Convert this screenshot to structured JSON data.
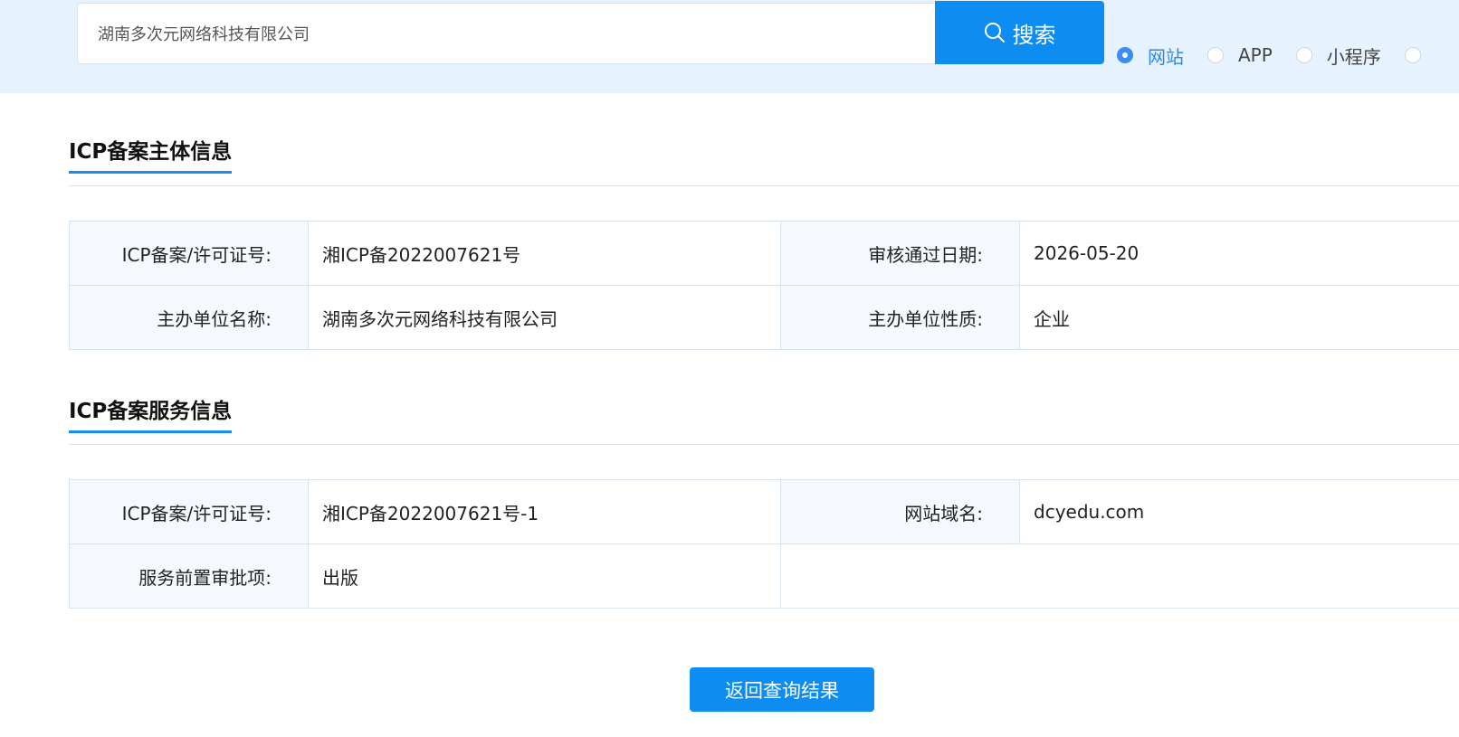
{
  "search": {
    "value": "湖南多次元网络科技有限公司",
    "button_label": "搜索"
  },
  "type_filter": {
    "selected": "网站",
    "options": [
      {
        "label": "网站",
        "checked": true
      },
      {
        "label": "APP",
        "checked": false
      },
      {
        "label": "小程序",
        "checked": false
      },
      {
        "label": "",
        "checked": false
      }
    ]
  },
  "entity_section": {
    "title": "ICP备案主体信息",
    "rows": [
      {
        "label1": "ICP备案/许可证号:",
        "value1": "湘ICP备2022007621号",
        "label2": "审核通过日期:",
        "value2": "2026-05-20"
      },
      {
        "label1": "主办单位名称:",
        "value1": "湖南多次元网络科技有限公司",
        "label2": "主办单位性质:",
        "value2": "企业"
      }
    ]
  },
  "service_section": {
    "title": "ICP备案服务信息",
    "rows": [
      {
        "label1": "ICP备案/许可证号:",
        "value1": "湘ICP备2022007621号-1",
        "label2": "网站域名:",
        "value2": "dcyedu.com"
      },
      {
        "label1": "服务前置审批项:",
        "value1": "出版"
      }
    ]
  },
  "back_button": {
    "label": "返回查询结果"
  },
  "colors": {
    "accent": "#0d8df2",
    "band_background": "#e6f2fd",
    "label_cell_background": "#f5f9fd",
    "border": "#d9e3ee"
  },
  "icons": {
    "search": "search-icon"
  }
}
